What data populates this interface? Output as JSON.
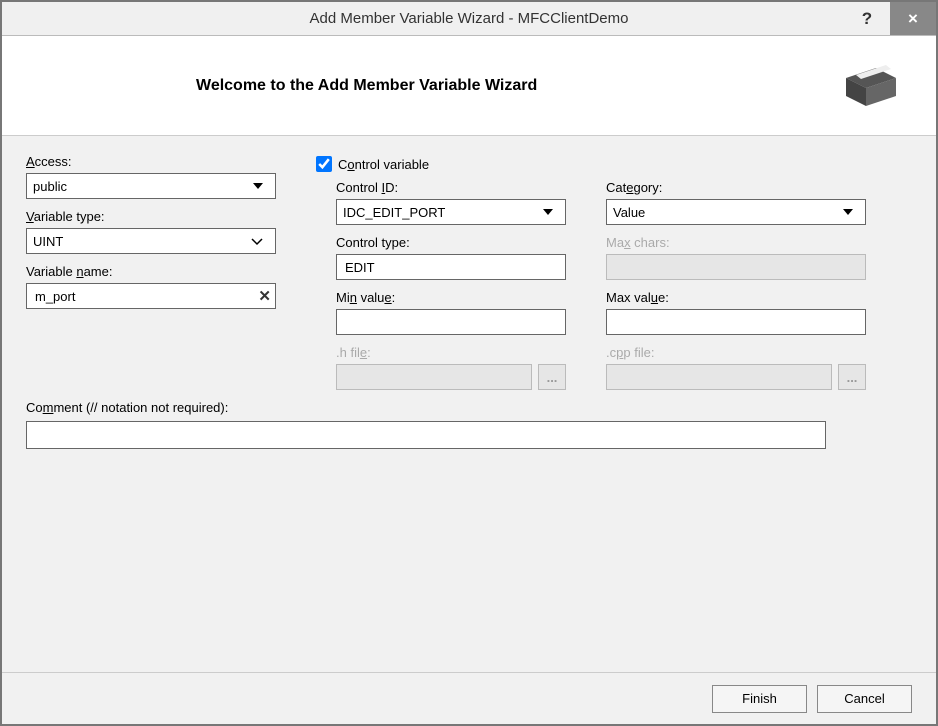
{
  "titlebar": {
    "title": "Add Member Variable Wizard - MFCClientDemo",
    "help": "?",
    "close": "×"
  },
  "header": {
    "title": "Welcome to the Add Member Variable Wizard"
  },
  "labels": {
    "access": "Access:",
    "variable_type": "Variable type:",
    "variable_name": "Variable name:",
    "control_variable": "Control variable",
    "control_id": "Control ID:",
    "control_type": "Control type:",
    "min_value": "Min value:",
    "h_file": ".h file:",
    "category": "Category:",
    "max_chars": "Max chars:",
    "max_value": "Max value:",
    "cpp_file": ".cpp file:",
    "comment": "Comment (// notation not required):"
  },
  "values": {
    "access": "public",
    "variable_type": "UINT",
    "variable_name": "m_port",
    "control_variable_checked": true,
    "control_id": "IDC_EDIT_PORT",
    "control_type": "EDIT",
    "min_value": "",
    "h_file": "",
    "category": "Value",
    "max_chars": "",
    "max_value": "",
    "cpp_file": "",
    "comment": ""
  },
  "buttons": {
    "finish": "Finish",
    "cancel": "Cancel",
    "browse": "..."
  }
}
